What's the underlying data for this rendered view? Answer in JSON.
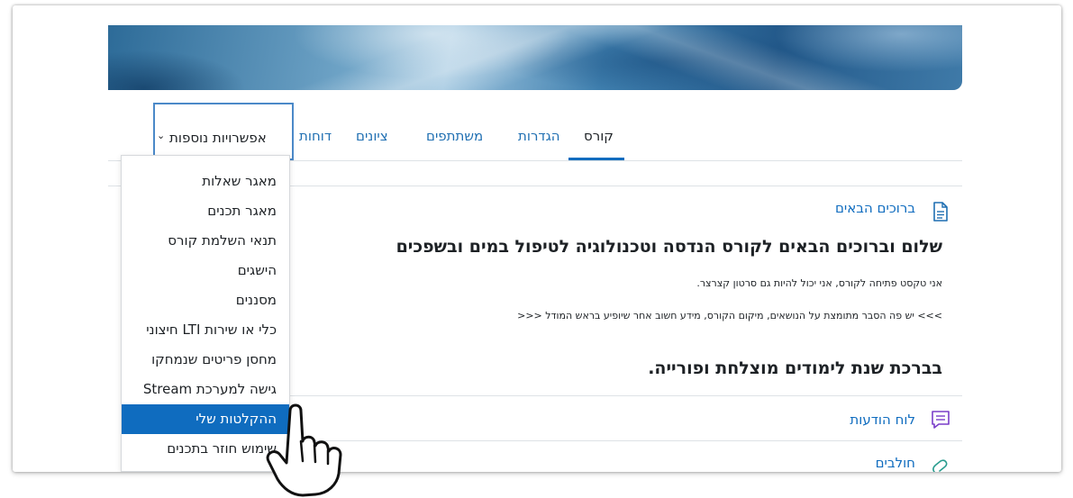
{
  "nav": {
    "tabs": [
      {
        "label": "קורס",
        "active": true
      },
      {
        "label": "הגדרות"
      },
      {
        "label": "משתתפים"
      },
      {
        "label": "ציונים"
      },
      {
        "label": "דוחות"
      }
    ],
    "more_label": "אפשרויות נוספות"
  },
  "dropdown": {
    "items": [
      {
        "label": "מאגר שאלות"
      },
      {
        "label": "מאגר תכנים"
      },
      {
        "label": "תנאי השלמת קורס"
      },
      {
        "label": "הישגים"
      },
      {
        "label": "מסננים"
      },
      {
        "label": "כלי או שירות LTI חיצוני"
      },
      {
        "label": "מחסן פריטים שנמחקו"
      },
      {
        "label": "גישה למערכת Stream"
      },
      {
        "label": "ההקלטות שלי",
        "active": true
      },
      {
        "label": "שימוש חוזר בתכנים"
      }
    ]
  },
  "content": {
    "welcome_link": "ברוכים הבאים",
    "heading": "שלום וברוכים הבאים לקורס הנדסה וטכנולוגיה לטיפול במים ובשפכים",
    "intro_text": "אני טקסט פתיחה לקורס, אני יכול להיות גם סרטון קצרצר.",
    "summary_text": ">>> יש פה הסבר מתומצת על הנושאים, מיקום הקורס, מידע חשוב אחר שיופיע בראש המודל <<<",
    "blessing": "בברכת שנת לימודים מוצלחת ופורייה.",
    "forum_link": "לוח הודעות",
    "next_link": "חולבים"
  },
  "colors": {
    "accent": "#0f6cbf",
    "link": "#1f6fb2",
    "forum_icon": "#7a3ec9",
    "more_border": "#4b89c8"
  },
  "icons": [
    "page-icon",
    "forum-icon",
    "link-icon",
    "chevron-down-icon",
    "hand-pointer-icon"
  ]
}
